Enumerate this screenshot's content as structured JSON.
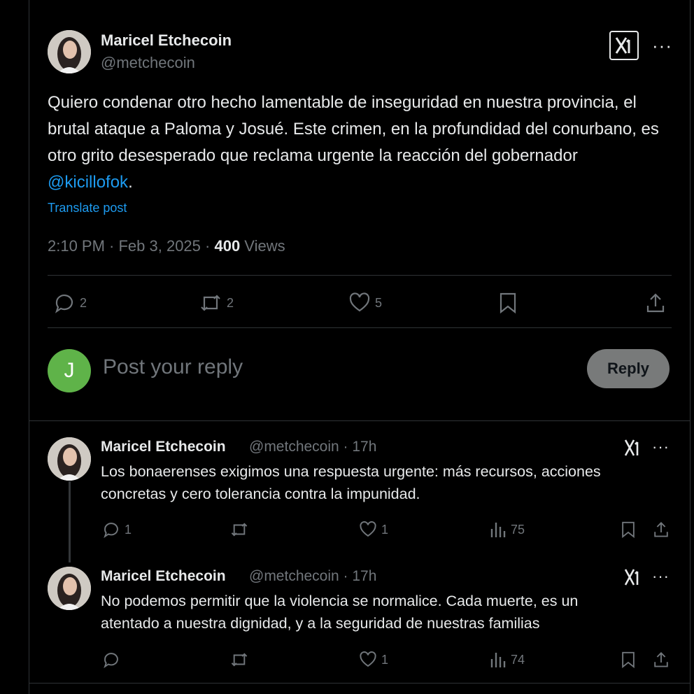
{
  "main_post": {
    "author_name": "Maricel Etchecoin",
    "author_handle": "@metchecoin",
    "text_before": "Quiero condenar otro hecho lamentable de inseguridad en nuestra provincia, el brutal ataque a Paloma y Josué. Este crimen, en la profundidad del conurbano, es otro grito desesperado que reclama urgente la reacción del gobernador ",
    "mention": "@kicillofok",
    "text_after": ".",
    "translate_label": "Translate post",
    "timestamp": "2:10 PM · Feb 3, 2025 · ",
    "views_count": "400",
    "views_label": " Views",
    "replies": "2",
    "reposts": "2",
    "likes": "5",
    "more_label": "···"
  },
  "reply_box": {
    "avatar_letter": "J",
    "placeholder": "Post your reply",
    "button_label": "Reply"
  },
  "replies": [
    {
      "author_name": "Maricel Etchecoin",
      "meta": "@metchecoin · 17h",
      "line1": "Los bonaerenses exigimos una respuesta urgente: más recursos, acciones",
      "line2": "concretas y cero tolerancia contra la impunidad.",
      "replies": "1",
      "reposts": "",
      "likes": "1",
      "views": "75",
      "more_label": "···"
    },
    {
      "author_name": "Maricel Etchecoin",
      "meta": "@metchecoin · 17h",
      "line1": "No podemos permitir que la violencia se normalice. Cada muerte, es un",
      "line2": "atentado a nuestra dignidad, y a la seguridad de nuestras familias",
      "replies": "",
      "reposts": "",
      "likes": "1",
      "views": "74",
      "more_label": "···"
    }
  ],
  "colors": {
    "background": "#000000",
    "text": "#e7e9ea",
    "muted": "#71767b",
    "accent": "#1d9bf0",
    "reply_avatar": "#5fb349"
  },
  "icons": [
    "x-logo-icon",
    "more-icon",
    "reply-icon",
    "repost-icon",
    "like-icon",
    "bookmark-icon",
    "share-icon",
    "views-icon"
  ]
}
